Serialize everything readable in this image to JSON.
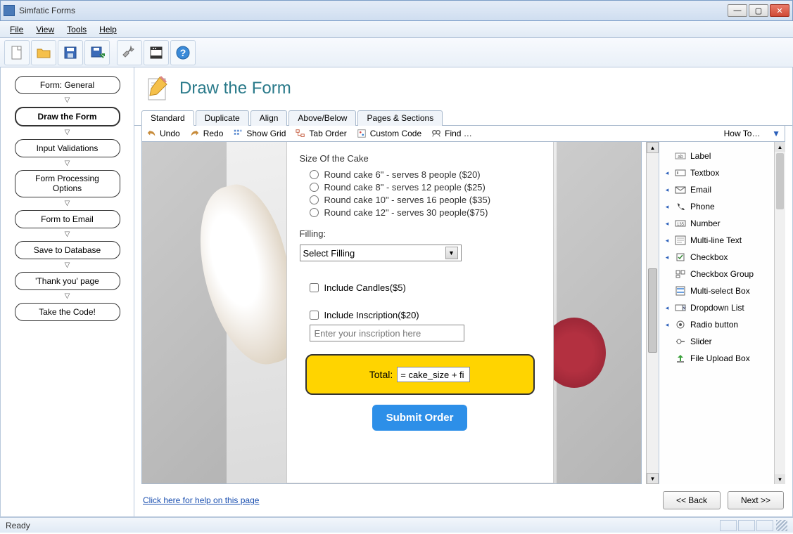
{
  "window": {
    "title": "Simfatic Forms"
  },
  "menu": {
    "file": "File",
    "view": "View",
    "tools": "Tools",
    "help": "Help"
  },
  "sidebar": {
    "steps": [
      "Form: General",
      "Draw the Form",
      "Input Validations",
      "Form Processing Options",
      "Form to Email",
      "Save to Database",
      "'Thank you' page",
      "Take the Code!"
    ]
  },
  "page": {
    "title": "Draw the Form"
  },
  "tabs": [
    "Standard",
    "Duplicate",
    "Align",
    "Above/Below",
    "Pages & Sections"
  ],
  "toolbar2": {
    "undo": "Undo",
    "redo": "Redo",
    "showgrid": "Show Grid",
    "taborder": "Tab Order",
    "customcode": "Custom Code",
    "find": "Find …",
    "howto": "How To…"
  },
  "form": {
    "size_label": "Size Of the Cake",
    "sizes": [
      "Round cake 6\" - serves 8 people ($20)",
      "Round cake 8\" - serves 12 people ($25)",
      "Round cake 10\" - serves 16 people ($35)",
      "Round cake 12\" - serves 30 people($75)"
    ],
    "filling_label": "Filling:",
    "filling_placeholder": "Select Filling",
    "candles_label": "Include Candles($5)",
    "inscription_label": "Include Inscription($20)",
    "inscription_placeholder": "Enter your inscription here",
    "total_label": "Total:",
    "total_value": "= cake_size + fi",
    "submit_label": "Submit Order"
  },
  "palette": {
    "items": [
      {
        "tri": "",
        "icon": "label",
        "label": "Label"
      },
      {
        "tri": "◂",
        "icon": "textbox",
        "label": "Textbox"
      },
      {
        "tri": "◂",
        "icon": "email",
        "label": "Email"
      },
      {
        "tri": "◂",
        "icon": "phone",
        "label": "Phone"
      },
      {
        "tri": "◂",
        "icon": "number",
        "label": "Number"
      },
      {
        "tri": "◂",
        "icon": "multiline",
        "label": "Multi-line Text"
      },
      {
        "tri": "◂",
        "icon": "checkbox",
        "label": "Checkbox"
      },
      {
        "tri": "",
        "icon": "checkboxgrp",
        "label": "Checkbox Group"
      },
      {
        "tri": "",
        "icon": "multiselect",
        "label": "Multi-select Box"
      },
      {
        "tri": "◂",
        "icon": "dropdown",
        "label": "Dropdown List"
      },
      {
        "tri": "◂",
        "icon": "radio",
        "label": "Radio button"
      },
      {
        "tri": "",
        "icon": "slider",
        "label": "Slider"
      },
      {
        "tri": "",
        "icon": "fileupload",
        "label": "File Upload Box"
      }
    ]
  },
  "bottom": {
    "help_link": "Click here for help on this page",
    "back": "<< Back",
    "next": "Next >>"
  },
  "status": {
    "ready": "Ready"
  }
}
